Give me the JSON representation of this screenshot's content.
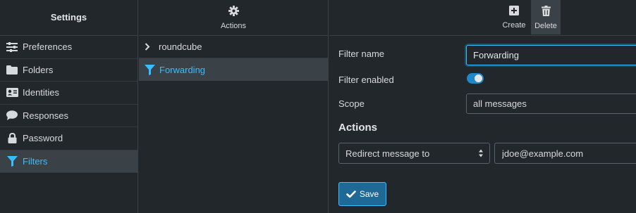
{
  "settings": {
    "title": "Settings",
    "menu": [
      {
        "label": "Preferences",
        "icon": "sliders-icon"
      },
      {
        "label": "Folders",
        "icon": "folder-icon"
      },
      {
        "label": "Identities",
        "icon": "id-card-icon"
      },
      {
        "label": "Responses",
        "icon": "comment-icon"
      },
      {
        "label": "Password",
        "icon": "lock-icon"
      },
      {
        "label": "Filters",
        "icon": "filter-icon",
        "active": true
      }
    ]
  },
  "filters_list": {
    "actions_label": "Actions",
    "filter_set": "roundcube",
    "filters": [
      {
        "label": "Forwarding",
        "selected": true
      }
    ]
  },
  "toolbar": {
    "create_label": "Create",
    "delete_label": "Delete"
  },
  "form": {
    "filter_name_label": "Filter name",
    "filter_name_value": "Forwarding",
    "filter_enabled_label": "Filter enabled",
    "filter_enabled": true,
    "scope_label": "Scope",
    "scope_value": "all messages",
    "actions_title": "Actions",
    "action_type": "Redirect message to",
    "action_target": "jdoe@example.com",
    "save_label": "Save"
  },
  "colors": {
    "background": "#21272b",
    "accent": "#37beff",
    "active_bg": "#3a4247",
    "save_button": "#1f6996"
  }
}
